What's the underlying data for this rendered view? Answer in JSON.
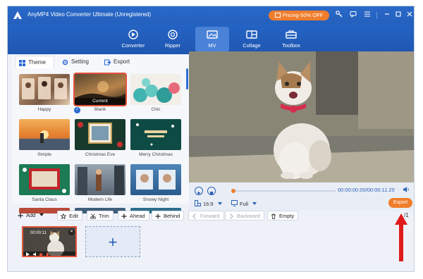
{
  "window": {
    "title": "AnyMP4 Video Converter Ultimate (Unregistered)"
  },
  "promo": {
    "label": "Pricing-50% OFF"
  },
  "titlebar_icons": [
    "key-icon",
    "chat-icon",
    "menu-icon",
    "minimize-icon",
    "maximize-icon",
    "close-icon"
  ],
  "nav": {
    "tabs": [
      {
        "label": "Converter",
        "icon": "converter-icon"
      },
      {
        "label": "Ripper",
        "icon": "disc-icon"
      },
      {
        "label": "MV",
        "icon": "mv-icon",
        "active": true
      },
      {
        "label": "Collage",
        "icon": "collage-icon"
      },
      {
        "label": "Toolbox",
        "icon": "toolbox-icon"
      }
    ]
  },
  "subtabs": [
    {
      "label": "Theme",
      "active": true
    },
    {
      "label": "Setting"
    },
    {
      "label": "Export"
    }
  ],
  "themes": [
    {
      "label": "Happy"
    },
    {
      "label": "Blank",
      "selected": true,
      "badge": "Current"
    },
    {
      "label": "Chic"
    },
    {
      "label": "Simple"
    },
    {
      "label": "Christmas Eve"
    },
    {
      "label": "Merry Christmas"
    },
    {
      "label": "Santa Claus"
    },
    {
      "label": "Modern Life"
    },
    {
      "label": "Snowy Night"
    }
  ],
  "player": {
    "time": "00:00:00.00/00:00:11.20",
    "aspect_ratio": "16:9",
    "view_mode": "Full",
    "export_label": "Export",
    "progress": 0
  },
  "toolbar": {
    "add": "Add",
    "edit": "Edit",
    "trim": "Trim",
    "ahead": "Ahead",
    "behind": "Behind",
    "forward": "Forward",
    "backward": "Backward",
    "empty": "Empty",
    "page": "/1"
  },
  "clip": {
    "time": "00:00:11"
  },
  "colors": {
    "accent": "#2a6ad3",
    "orange": "#f07d2b",
    "selection": "#e5533c",
    "arrow": "#e01b1b"
  }
}
